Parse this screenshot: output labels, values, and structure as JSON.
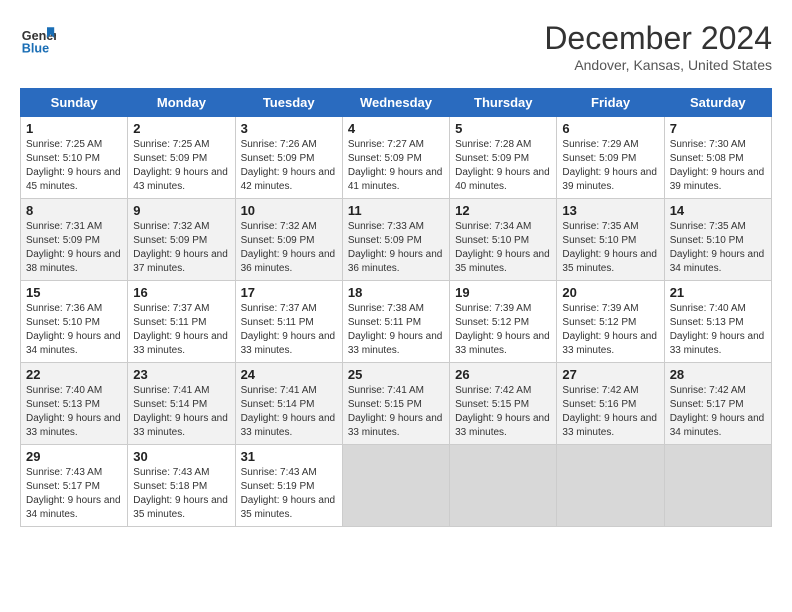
{
  "logo": {
    "line1": "General",
    "line2": "Blue"
  },
  "title": "December 2024",
  "location": "Andover, Kansas, United States",
  "days_of_week": [
    "Sunday",
    "Monday",
    "Tuesday",
    "Wednesday",
    "Thursday",
    "Friday",
    "Saturday"
  ],
  "weeks": [
    [
      {
        "day": "1",
        "sunrise": "7:25 AM",
        "sunset": "5:10 PM",
        "daylight": "9 hours and 45 minutes."
      },
      {
        "day": "2",
        "sunrise": "7:25 AM",
        "sunset": "5:09 PM",
        "daylight": "9 hours and 43 minutes."
      },
      {
        "day": "3",
        "sunrise": "7:26 AM",
        "sunset": "5:09 PM",
        "daylight": "9 hours and 42 minutes."
      },
      {
        "day": "4",
        "sunrise": "7:27 AM",
        "sunset": "5:09 PM",
        "daylight": "9 hours and 41 minutes."
      },
      {
        "day": "5",
        "sunrise": "7:28 AM",
        "sunset": "5:09 PM",
        "daylight": "9 hours and 40 minutes."
      },
      {
        "day": "6",
        "sunrise": "7:29 AM",
        "sunset": "5:09 PM",
        "daylight": "9 hours and 39 minutes."
      },
      {
        "day": "7",
        "sunrise": "7:30 AM",
        "sunset": "5:08 PM",
        "daylight": "9 hours and 39 minutes."
      }
    ],
    [
      {
        "day": "8",
        "sunrise": "7:31 AM",
        "sunset": "5:09 PM",
        "daylight": "9 hours and 38 minutes."
      },
      {
        "day": "9",
        "sunrise": "7:32 AM",
        "sunset": "5:09 PM",
        "daylight": "9 hours and 37 minutes."
      },
      {
        "day": "10",
        "sunrise": "7:32 AM",
        "sunset": "5:09 PM",
        "daylight": "9 hours and 36 minutes."
      },
      {
        "day": "11",
        "sunrise": "7:33 AM",
        "sunset": "5:09 PM",
        "daylight": "9 hours and 36 minutes."
      },
      {
        "day": "12",
        "sunrise": "7:34 AM",
        "sunset": "5:10 PM",
        "daylight": "9 hours and 35 minutes."
      },
      {
        "day": "13",
        "sunrise": "7:35 AM",
        "sunset": "5:10 PM",
        "daylight": "9 hours and 35 minutes."
      },
      {
        "day": "14",
        "sunrise": "7:35 AM",
        "sunset": "5:10 PM",
        "daylight": "9 hours and 34 minutes."
      }
    ],
    [
      {
        "day": "15",
        "sunrise": "7:36 AM",
        "sunset": "5:10 PM",
        "daylight": "9 hours and 34 minutes."
      },
      {
        "day": "16",
        "sunrise": "7:37 AM",
        "sunset": "5:11 PM",
        "daylight": "9 hours and 33 minutes."
      },
      {
        "day": "17",
        "sunrise": "7:37 AM",
        "sunset": "5:11 PM",
        "daylight": "9 hours and 33 minutes."
      },
      {
        "day": "18",
        "sunrise": "7:38 AM",
        "sunset": "5:11 PM",
        "daylight": "9 hours and 33 minutes."
      },
      {
        "day": "19",
        "sunrise": "7:39 AM",
        "sunset": "5:12 PM",
        "daylight": "9 hours and 33 minutes."
      },
      {
        "day": "20",
        "sunrise": "7:39 AM",
        "sunset": "5:12 PM",
        "daylight": "9 hours and 33 minutes."
      },
      {
        "day": "21",
        "sunrise": "7:40 AM",
        "sunset": "5:13 PM",
        "daylight": "9 hours and 33 minutes."
      }
    ],
    [
      {
        "day": "22",
        "sunrise": "7:40 AM",
        "sunset": "5:13 PM",
        "daylight": "9 hours and 33 minutes."
      },
      {
        "day": "23",
        "sunrise": "7:41 AM",
        "sunset": "5:14 PM",
        "daylight": "9 hours and 33 minutes."
      },
      {
        "day": "24",
        "sunrise": "7:41 AM",
        "sunset": "5:14 PM",
        "daylight": "9 hours and 33 minutes."
      },
      {
        "day": "25",
        "sunrise": "7:41 AM",
        "sunset": "5:15 PM",
        "daylight": "9 hours and 33 minutes."
      },
      {
        "day": "26",
        "sunrise": "7:42 AM",
        "sunset": "5:15 PM",
        "daylight": "9 hours and 33 minutes."
      },
      {
        "day": "27",
        "sunrise": "7:42 AM",
        "sunset": "5:16 PM",
        "daylight": "9 hours and 33 minutes."
      },
      {
        "day": "28",
        "sunrise": "7:42 AM",
        "sunset": "5:17 PM",
        "daylight": "9 hours and 34 minutes."
      }
    ],
    [
      {
        "day": "29",
        "sunrise": "7:43 AM",
        "sunset": "5:17 PM",
        "daylight": "9 hours and 34 minutes."
      },
      {
        "day": "30",
        "sunrise": "7:43 AM",
        "sunset": "5:18 PM",
        "daylight": "9 hours and 35 minutes."
      },
      {
        "day": "31",
        "sunrise": "7:43 AM",
        "sunset": "5:19 PM",
        "daylight": "9 hours and 35 minutes."
      },
      null,
      null,
      null,
      null
    ]
  ]
}
